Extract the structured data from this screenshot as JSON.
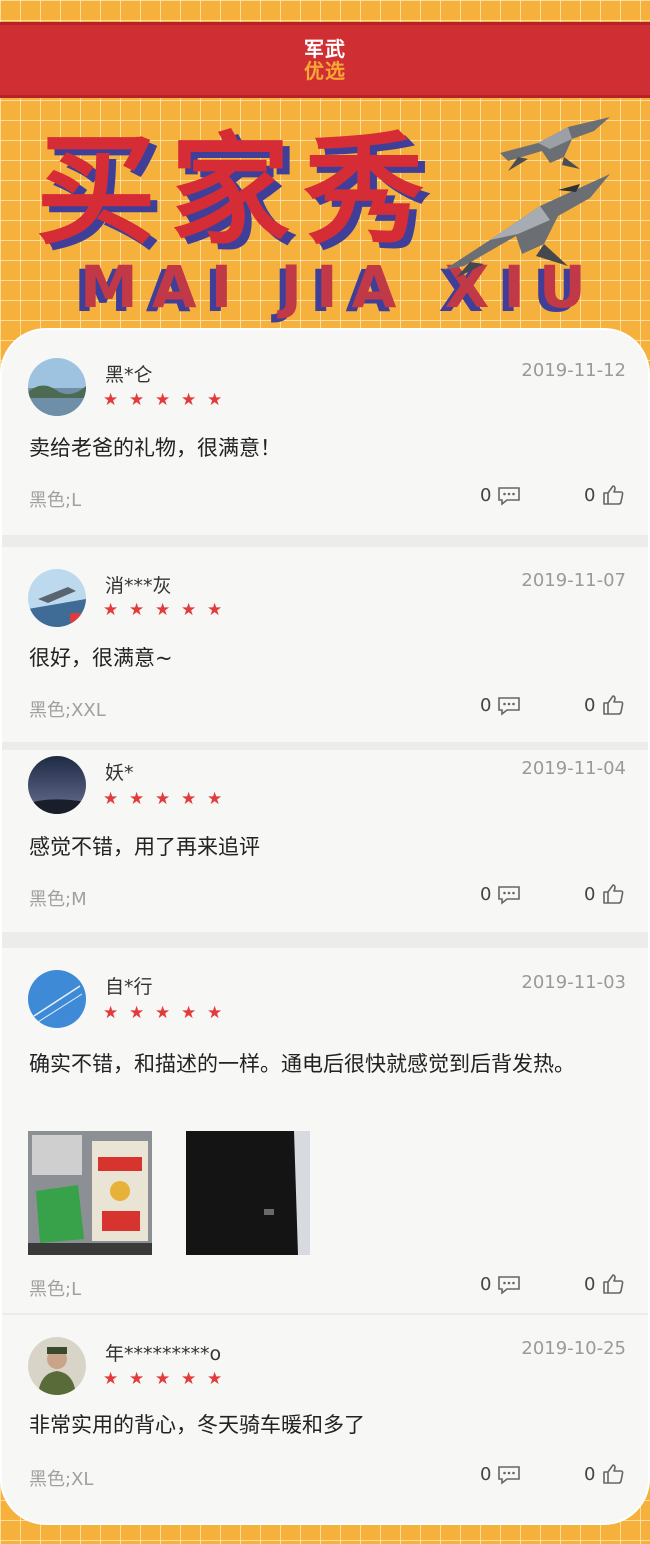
{
  "header": {
    "logo_line1": "军武",
    "logo_line2": "优选"
  },
  "hero": {
    "title": "买家秀",
    "subtitle": "MAI JIA XIU"
  },
  "reviews": [
    {
      "user": "黑*仑",
      "date": "2019-11-12",
      "rating": 5,
      "content": "卖给老爸的礼物，很满意！",
      "spec": "黑色;L",
      "comments": "0",
      "likes": "0",
      "avatar": "landscape-lake-avatar"
    },
    {
      "user": "消***灰",
      "date": "2019-11-07",
      "rating": 5,
      "content": "很好，很满意~",
      "spec": "黑色;XXL",
      "comments": "0",
      "likes": "0",
      "avatar": "game-app-avatar"
    },
    {
      "user": "妖*",
      "date": "2019-11-04",
      "rating": 5,
      "content": "感觉不错，用了再来追评",
      "spec": "黑色;M",
      "comments": "0",
      "likes": "0",
      "avatar": "night-sky-avatar"
    },
    {
      "user": "自*行",
      "date": "2019-11-03",
      "rating": 5,
      "content": "确实不错，和描述的一样。通电后很快就感觉到后背发热。",
      "spec": "黑色;L",
      "comments": "0",
      "likes": "0",
      "avatar": "blue-sky-avatar",
      "photos": [
        "product-package-photo",
        "black-vest-photo"
      ]
    },
    {
      "user": "年*********o",
      "date": "2019-10-25",
      "rating": 5,
      "content": "非常实用的背心，冬天骑车暖和多了",
      "spec": "黑色;XL",
      "comments": "0",
      "likes": "0",
      "avatar": "person-portrait-avatar"
    }
  ],
  "icons": {
    "star": "star-icon",
    "comment": "comment-icon",
    "like": "thumbs-up-icon"
  },
  "colors": {
    "brand_red": "#cf2f33",
    "star_red": "#e23b3b",
    "background_orange": "#f6b13c"
  }
}
